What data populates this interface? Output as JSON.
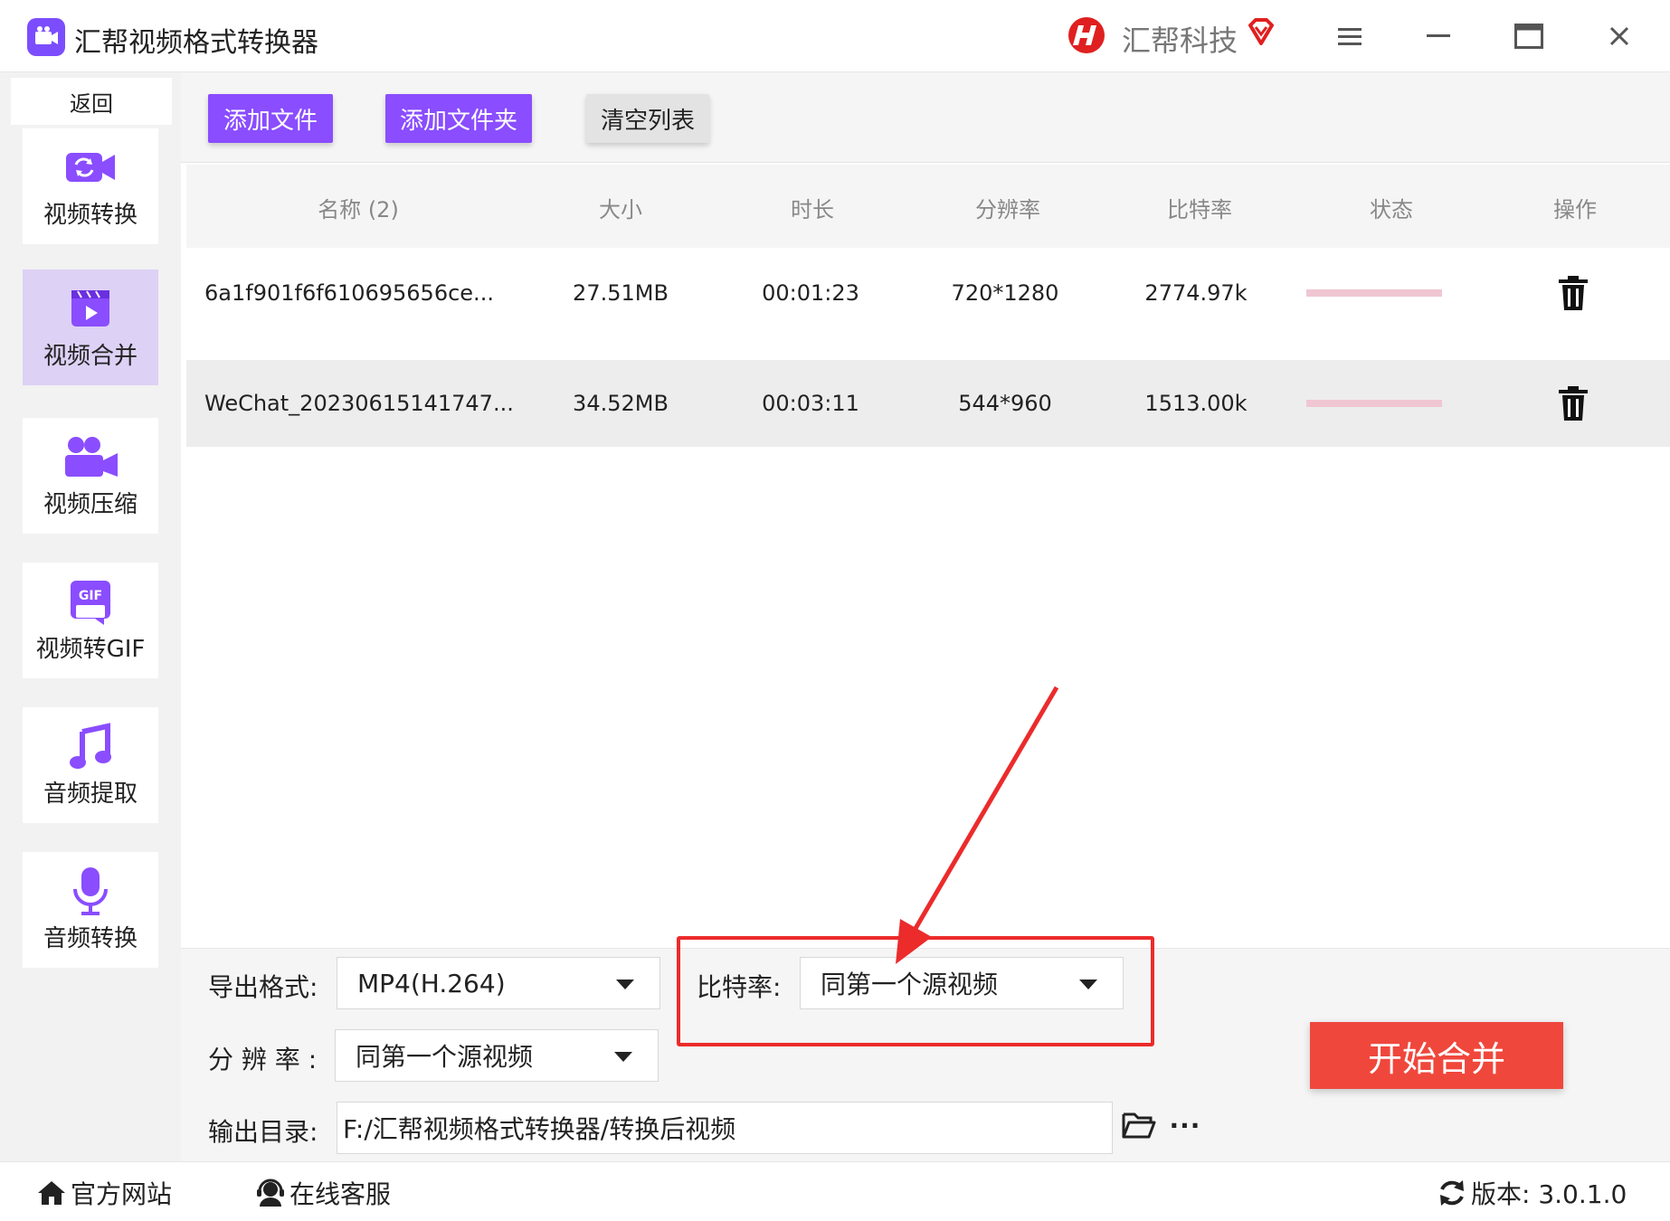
{
  "app": {
    "title": "汇帮视频格式转换器",
    "brand_name": "汇帮科技"
  },
  "sidebar": {
    "back_label": "返回",
    "items": [
      {
        "label": "视频转换",
        "icon": "video-convert-icon",
        "active": false
      },
      {
        "label": "视频合并",
        "icon": "video-merge-icon",
        "active": true
      },
      {
        "label": "视频压缩",
        "icon": "video-compress-icon",
        "active": false
      },
      {
        "label": "视频转GIF",
        "icon": "gif-icon",
        "active": false
      },
      {
        "label": "音频提取",
        "icon": "music-note-icon",
        "active": false
      },
      {
        "label": "音频转换",
        "icon": "microphone-icon",
        "active": false
      }
    ]
  },
  "toolbar": {
    "add_file": "添加文件",
    "add_folder": "添加文件夹",
    "clear_list": "清空列表"
  },
  "table": {
    "headers": {
      "name": "名称 (2)",
      "size": "大小",
      "duration": "时长",
      "resolution": "分辨率",
      "bitrate": "比特率",
      "status": "状态",
      "action": "操作"
    },
    "rows": [
      {
        "name": "6a1f901f6f610695656ce...",
        "size": "27.51MB",
        "duration": "00:01:23",
        "resolution": "720*1280",
        "bitrate": "2774.97k",
        "progress": 0
      },
      {
        "name": "WeChat_20230615141747...",
        "size": "34.52MB",
        "duration": "00:03:11",
        "resolution": "544*960",
        "bitrate": "1513.00k",
        "progress": 0
      }
    ]
  },
  "settings": {
    "export_format_label": "导出格式:",
    "export_format_value": "MP4(H.264)",
    "bitrate_label": "比特率:",
    "bitrate_value": "同第一个源视频",
    "resolution_label": "分 辨 率 :",
    "resolution_value": "同第一个源视频",
    "output_dir_label": "输出目录:",
    "output_dir_value": "F:/汇帮视频格式转换器/转换后视频",
    "more_label": "···"
  },
  "start_button": "开始合并",
  "footer": {
    "website": "官方网站",
    "support": "在线客服",
    "version": "版本: 3.0.1.0"
  },
  "colors": {
    "accent_purple": "#8a4dff",
    "active_nav_bg": "#ddd1f5",
    "start_red": "#f0473c",
    "annotation_red": "#ec2b2b",
    "progress_pink": "#f0c6d3"
  }
}
